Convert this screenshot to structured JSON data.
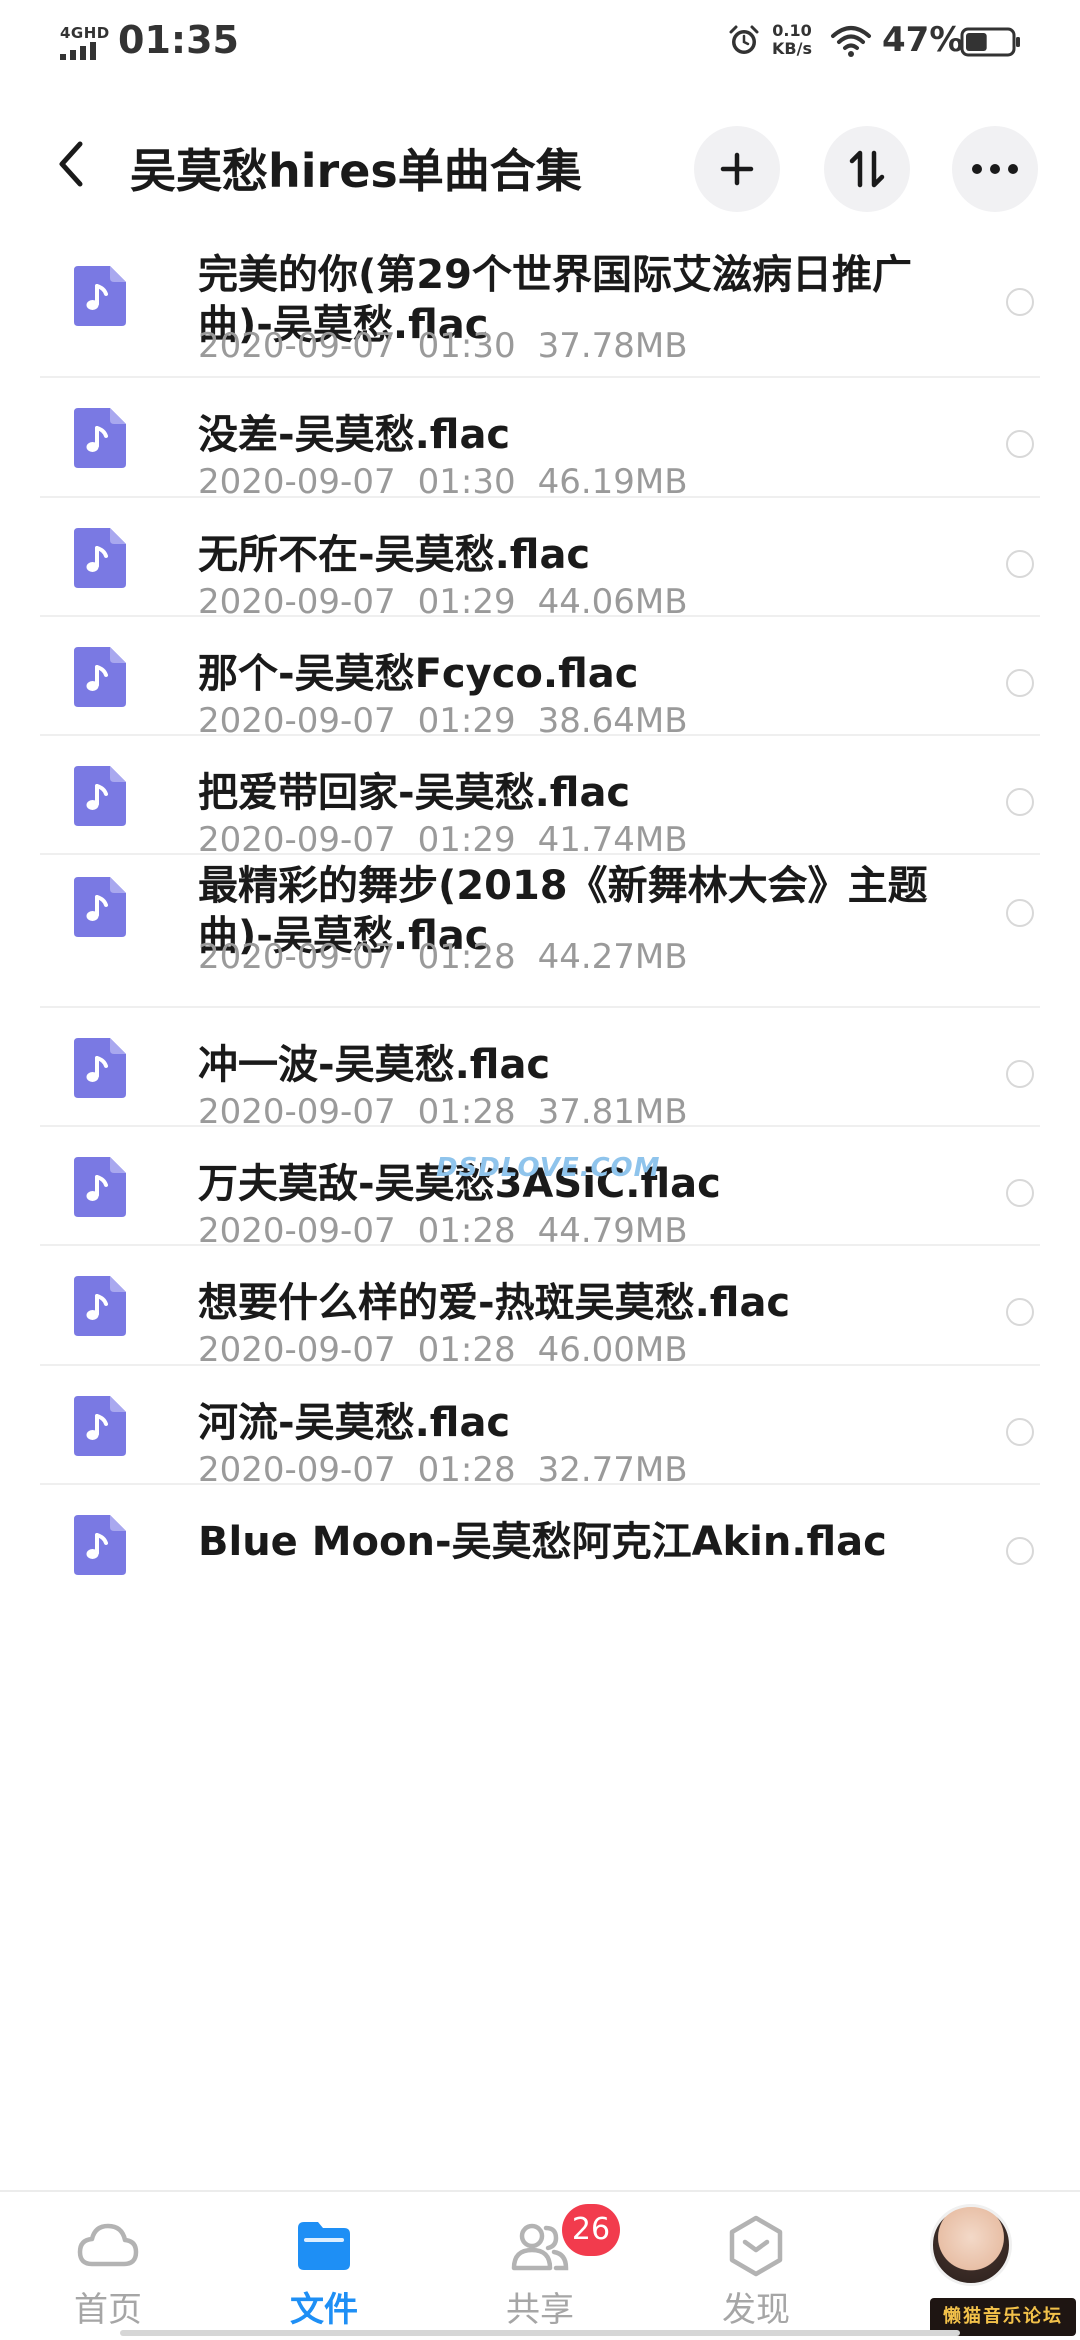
{
  "status_bar": {
    "network": "4GHD",
    "time": "01:35",
    "speed_value": "0.10",
    "speed_unit": "KB/s",
    "battery_percent": "47%",
    "battery_level": 0.47
  },
  "header": {
    "title": "吴莫愁hires单曲合集"
  },
  "files": [
    {
      "name": "完美的你(第29个世界国际艾滋病日推广曲)-吴莫愁.flac",
      "date": "2020-09-07",
      "time": "01:30",
      "size": "37.78MB"
    },
    {
      "name": "没差-吴莫愁.flac",
      "date": "2020-09-07",
      "time": "01:30",
      "size": "46.19MB"
    },
    {
      "name": "无所不在-吴莫愁.flac",
      "date": "2020-09-07",
      "time": "01:29",
      "size": "44.06MB"
    },
    {
      "name": "那个-吴莫愁Fcyco.flac",
      "date": "2020-09-07",
      "time": "01:29",
      "size": "38.64MB"
    },
    {
      "name": "把爱带回家-吴莫愁.flac",
      "date": "2020-09-07",
      "time": "01:29",
      "size": "41.74MB"
    },
    {
      "name": "最精彩的舞步(2018《新舞林大会》主题曲)-吴莫愁.flac",
      "date": "2020-09-07",
      "time": "01:28",
      "size": "44.27MB"
    },
    {
      "name": "冲一波-吴莫愁.flac",
      "date": "2020-09-07",
      "time": "01:28",
      "size": "37.81MB"
    },
    {
      "name": "万夫莫敌-吴莫愁3ASiC.flac",
      "date": "2020-09-07",
      "time": "01:28",
      "size": "44.79MB"
    },
    {
      "name": "想要什么样的爱-热斑吴莫愁.flac",
      "date": "2020-09-07",
      "time": "01:28",
      "size": "46.00MB"
    },
    {
      "name": "河流-吴莫愁.flac",
      "date": "2020-09-07",
      "time": "01:28",
      "size": "32.77MB"
    },
    {
      "name": "Blue Moon-吴莫愁阿克江Akin.flac",
      "date": "",
      "time": "",
      "size": ""
    }
  ],
  "watermark": "DSDLOVE.COM",
  "bottom_nav": {
    "home": "首页",
    "files": "文件",
    "share": "共享",
    "discover": "发现",
    "share_badge": "26"
  },
  "forum_logo": "懒猫音乐论坛",
  "colors": {
    "file_icon": "#7a79e3",
    "active_tab": "#1e8ff5",
    "badge": "#f23b4d"
  },
  "icons": {
    "file": "music-file-icon",
    "back": "back-chevron-icon",
    "add": "plus-icon",
    "sort": "sort-arrows-icon",
    "more": "more-dots-icon"
  }
}
